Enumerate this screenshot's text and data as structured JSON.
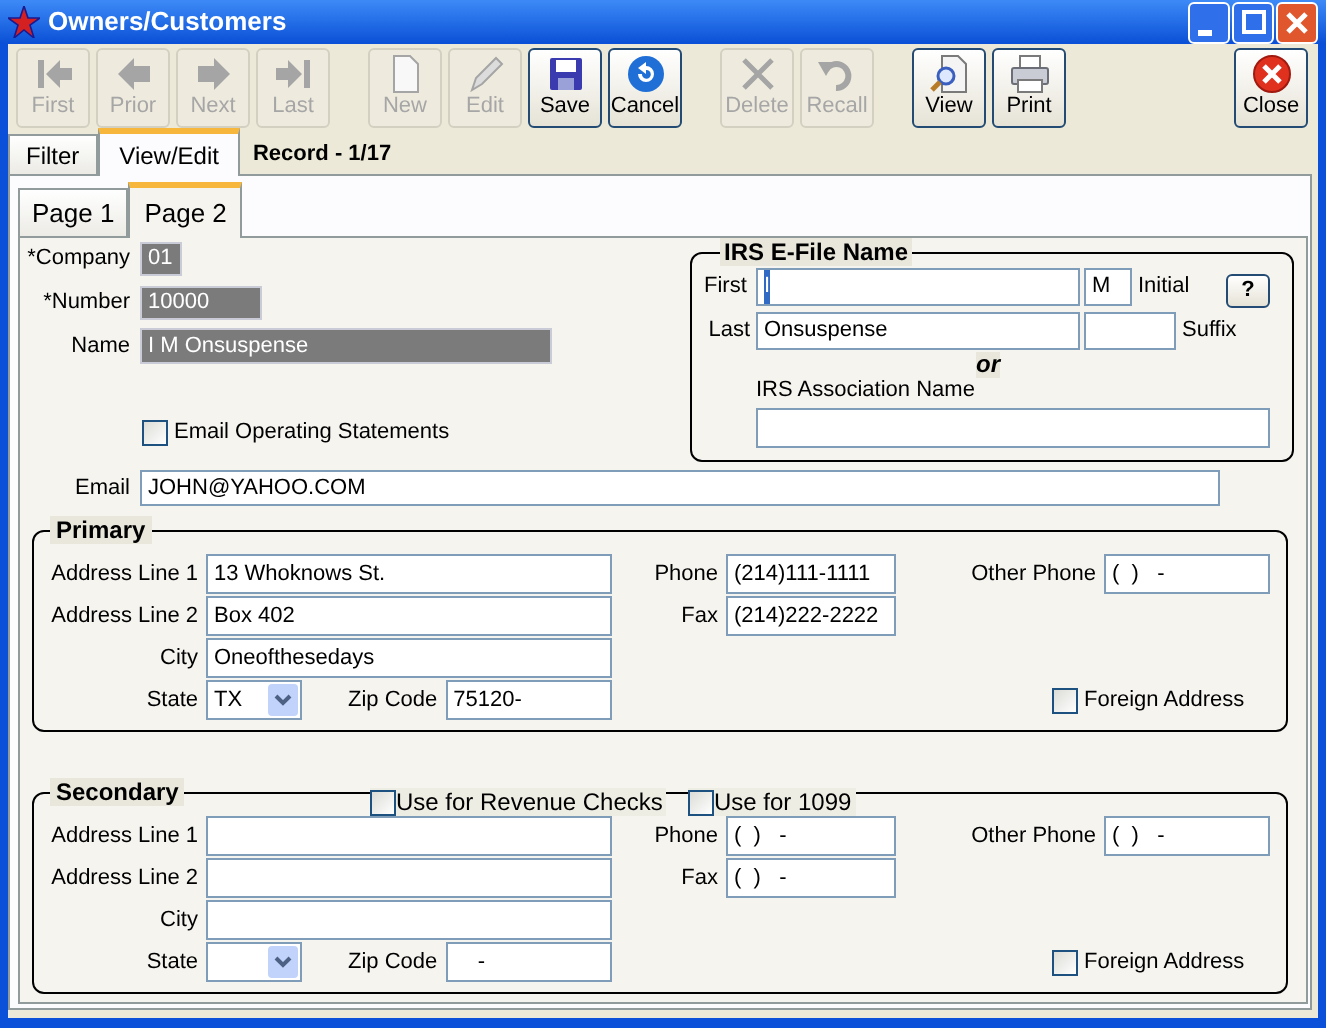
{
  "window": {
    "title": "Owners/Customers"
  },
  "toolbar": [
    {
      "buttons": [
        {
          "label": "First",
          "kind": "first",
          "disabled": true
        },
        {
          "label": "Prior",
          "kind": "prior",
          "disabled": true
        },
        {
          "label": "Next",
          "kind": "next",
          "disabled": true
        },
        {
          "label": "Last",
          "kind": "last",
          "disabled": true
        }
      ]
    },
    {
      "buttons": [
        {
          "label": "New",
          "kind": "new",
          "disabled": true
        },
        {
          "label": "Edit",
          "kind": "edit",
          "disabled": true
        },
        {
          "label": "Save",
          "kind": "save",
          "disabled": false
        },
        {
          "label": "Cancel",
          "kind": "cancel",
          "disabled": false
        }
      ]
    },
    {
      "buttons": [
        {
          "label": "Delete",
          "kind": "delete",
          "disabled": true
        },
        {
          "label": "Recall",
          "kind": "recall",
          "disabled": true
        }
      ]
    },
    {
      "buttons": [
        {
          "label": "View",
          "kind": "view",
          "disabled": false
        },
        {
          "label": "Print",
          "kind": "print",
          "disabled": false
        }
      ]
    },
    {
      "buttons": [
        {
          "label": "Close",
          "kind": "close",
          "disabled": false
        }
      ]
    }
  ],
  "tabs": [
    {
      "label": "Filter",
      "selected": false
    },
    {
      "label": "View/Edit",
      "selected": true
    }
  ],
  "record": "Record - 1/17",
  "pages": [
    {
      "label": "Page 1",
      "selected": false
    },
    {
      "label": "Page 2",
      "selected": true
    }
  ],
  "company": {
    "label": "*Company",
    "value": "01",
    "locked": true
  },
  "number": {
    "label": "*Number",
    "value": "10000",
    "locked": true
  },
  "name": {
    "label": "Name",
    "value": "I M Onsuspense",
    "locked": true
  },
  "email_statements": {
    "label": "Email Operating Statements",
    "checked": false
  },
  "email": {
    "label": "Email",
    "value": "JOHN@YAHOO.COM"
  },
  "irs": {
    "title": "IRS E-File Name",
    "first": {
      "label": "First",
      "value": "I",
      "focused": true
    },
    "initial": {
      "label": "Initial",
      "value": "M"
    },
    "help": "?",
    "last": {
      "label": "Last",
      "value": "Onsuspense"
    },
    "suffix": {
      "label": "Suffix"
    },
    "or": "or",
    "association": {
      "label": "IRS Association Name"
    }
  },
  "addresses": [
    {
      "title": "Primary",
      "address_line_1": {
        "label": "Address Line 1",
        "value": "13 Whoknows St."
      },
      "address_line_2": {
        "label": "Address Line 2",
        "value": "Box 402"
      },
      "city": {
        "label": "City",
        "value": "Oneofthesedays"
      },
      "state": {
        "label": "State",
        "value": "TX"
      },
      "zip": {
        "label": "Zip Code",
        "value": "75120-"
      },
      "phone": {
        "label": "Phone",
        "value": "(214)111-1111"
      },
      "fax": {
        "label": "Fax",
        "value": "(214)222-2222"
      },
      "other_phone": {
        "label": "Other Phone",
        "value": "(  )   -"
      },
      "foreign": {
        "label": "Foreign Address",
        "checked": false
      }
    },
    {
      "title": "Secondary",
      "options": [
        {
          "label": "Use for Revenue Checks",
          "checked": false
        },
        {
          "label": "Use for 1099",
          "checked": false
        }
      ],
      "address_line_1": {
        "label": "Address Line 1"
      },
      "address_line_2": {
        "label": "Address Line 2"
      },
      "city": {
        "label": "City"
      },
      "state": {
        "label": "State"
      },
      "zip": {
        "label": "Zip Code",
        "value": "    -"
      },
      "phone": {
        "label": "Phone",
        "value": "(  )   -"
      },
      "fax": {
        "label": "Fax",
        "value": "(  )   -"
      },
      "other_phone": {
        "label": "Other Phone",
        "value": "(  )   -"
      },
      "foreign": {
        "label": "Foreign Address",
        "checked": false
      }
    }
  ]
}
